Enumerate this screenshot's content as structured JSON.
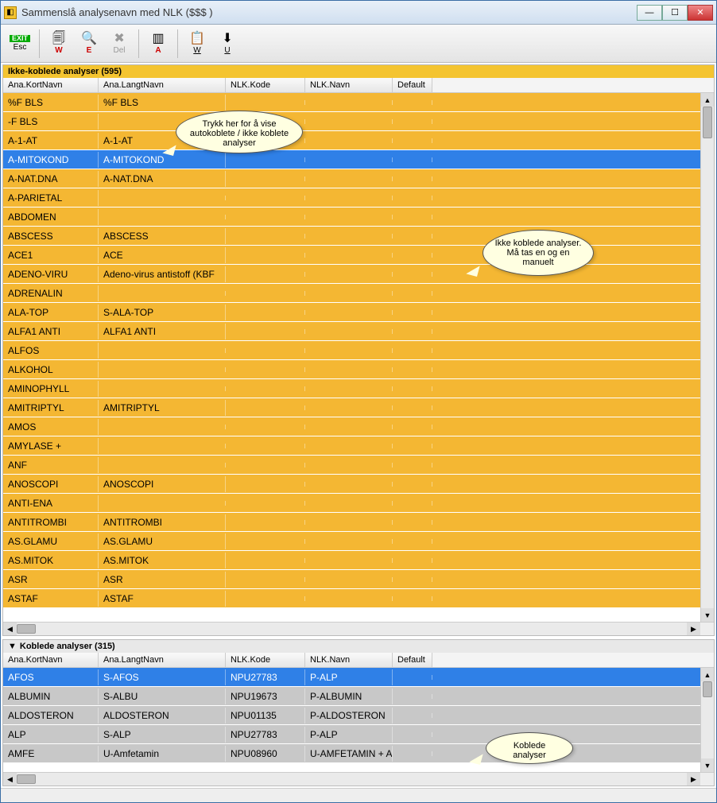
{
  "window": {
    "title": "Sammenslå analysenavn med NLK ($$$ )"
  },
  "toolbar": {
    "exit": "Esc",
    "w": "W",
    "e": "E",
    "del": "Del",
    "a": "A",
    "w2": "W",
    "u": "U"
  },
  "callouts": {
    "top": "Trykk her for å vise autokoblete / ikke koblete analyser",
    "right": "Ikke koblede analyser. Må tas en og en manuelt",
    "bottom": "Koblede analyser"
  },
  "top_section": {
    "title": "Ikke-koblede analyser  (595)",
    "columns": [
      "Ana.KortNavn",
      "Ana.LangtNavn",
      "NLK.Kode",
      "NLK.Navn",
      "Default"
    ],
    "selected_index": 3,
    "rows": [
      {
        "kort": "%F BLS",
        "lang": "%F BLS",
        "kode": "",
        "navn": "",
        "def": ""
      },
      {
        "kort": "-F BLS",
        "lang": "",
        "kode": "",
        "navn": "",
        "def": ""
      },
      {
        "kort": "A-1-AT",
        "lang": "A-1-AT",
        "kode": "",
        "navn": "",
        "def": ""
      },
      {
        "kort": "A-MITOKOND",
        "lang": "A-MITOKOND",
        "kode": "",
        "navn": "",
        "def": ""
      },
      {
        "kort": "A-NAT.DNA",
        "lang": "A-NAT.DNA",
        "kode": "",
        "navn": "",
        "def": ""
      },
      {
        "kort": "A-PARIETAL",
        "lang": "",
        "kode": "",
        "navn": "",
        "def": ""
      },
      {
        "kort": "ABDOMEN",
        "lang": "",
        "kode": "",
        "navn": "",
        "def": ""
      },
      {
        "kort": "ABSCESS",
        "lang": "ABSCESS",
        "kode": "",
        "navn": "",
        "def": ""
      },
      {
        "kort": "ACE1",
        "lang": "ACE",
        "kode": "",
        "navn": "",
        "def": ""
      },
      {
        "kort": "ADENO-VIRU",
        "lang": "Adeno-virus antistoff (KBF",
        "kode": "",
        "navn": "",
        "def": ""
      },
      {
        "kort": "ADRENALIN",
        "lang": "",
        "kode": "",
        "navn": "",
        "def": ""
      },
      {
        "kort": "ALA-TOP",
        "lang": "S-ALA-TOP",
        "kode": "",
        "navn": "",
        "def": ""
      },
      {
        "kort": "ALFA1 ANTI",
        "lang": "ALFA1 ANTI",
        "kode": "",
        "navn": "",
        "def": ""
      },
      {
        "kort": "ALFOS",
        "lang": "",
        "kode": "",
        "navn": "",
        "def": ""
      },
      {
        "kort": "ALKOHOL",
        "lang": "",
        "kode": "",
        "navn": "",
        "def": ""
      },
      {
        "kort": "AMINOPHYLL",
        "lang": "",
        "kode": "",
        "navn": "",
        "def": ""
      },
      {
        "kort": "AMITRIPTYL",
        "lang": "AMITRIPTYL",
        "kode": "",
        "navn": "",
        "def": ""
      },
      {
        "kort": "AMOS",
        "lang": "",
        "kode": "",
        "navn": "",
        "def": ""
      },
      {
        "kort": "AMYLASE +",
        "lang": "",
        "kode": "",
        "navn": "",
        "def": ""
      },
      {
        "kort": "ANF",
        "lang": "",
        "kode": "",
        "navn": "",
        "def": ""
      },
      {
        "kort": "ANOSCOPI",
        "lang": "ANOSCOPI",
        "kode": "",
        "navn": "",
        "def": ""
      },
      {
        "kort": "ANTI-ENA",
        "lang": "",
        "kode": "",
        "navn": "",
        "def": ""
      },
      {
        "kort": "ANTITROMBI",
        "lang": "ANTITROMBI",
        "kode": "",
        "navn": "",
        "def": ""
      },
      {
        "kort": "AS.GLAMU",
        "lang": "AS.GLAMU",
        "kode": "",
        "navn": "",
        "def": ""
      },
      {
        "kort": "AS.MITOK",
        "lang": "AS.MITOK",
        "kode": "",
        "navn": "",
        "def": ""
      },
      {
        "kort": "ASR",
        "lang": "ASR",
        "kode": "",
        "navn": "",
        "def": ""
      },
      {
        "kort": "ASTAF",
        "lang": "ASTAF",
        "kode": "",
        "navn": "",
        "def": ""
      }
    ]
  },
  "bottom_section": {
    "title": "Koblede analyser  (315)",
    "columns": [
      "Ana.KortNavn",
      "Ana.LangtNavn",
      "NLK.Kode",
      "NLK.Navn",
      "Default"
    ],
    "selected_index": 0,
    "rows": [
      {
        "kort": "AFOS",
        "lang": "S-AFOS",
        "kode": "NPU27783",
        "navn": "P-ALP",
        "def": ""
      },
      {
        "kort": "ALBUMIN",
        "lang": "S-ALBU",
        "kode": "NPU19673",
        "navn": "P-ALBUMIN",
        "def": ""
      },
      {
        "kort": "ALDOSTERON",
        "lang": "ALDOSTERON",
        "kode": "NPU01135",
        "navn": "P-ALDOSTERON",
        "def": ""
      },
      {
        "kort": "ALP",
        "lang": "S-ALP",
        "kode": "NPU27783",
        "navn": "P-ALP",
        "def": ""
      },
      {
        "kort": "AMFE",
        "lang": "U-Amfetamin",
        "kode": "NPU08960",
        "navn": "U-AMFETAMIN + AM",
        "def": ""
      }
    ]
  }
}
